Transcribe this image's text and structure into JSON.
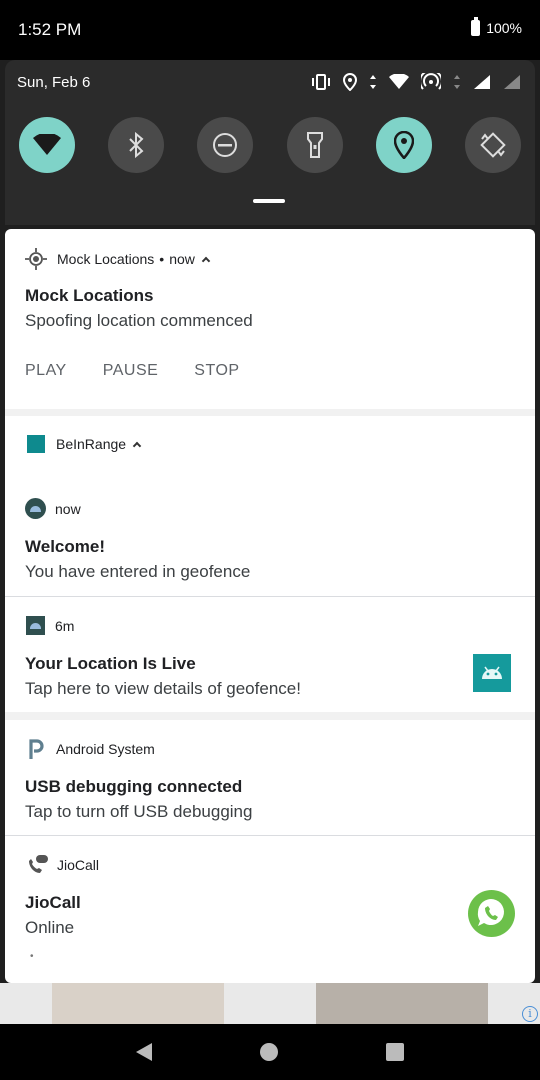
{
  "status_bar": {
    "time": "1:52 PM",
    "battery": "100%"
  },
  "quick_settings": {
    "date": "Sun, Feb 6",
    "tiles": [
      {
        "icon": "wifi-icon",
        "active": true
      },
      {
        "icon": "bluetooth-icon",
        "active": false
      },
      {
        "icon": "do-not-disturb-icon",
        "active": false
      },
      {
        "icon": "flashlight-icon",
        "active": false
      },
      {
        "icon": "location-icon",
        "active": true
      },
      {
        "icon": "auto-rotate-icon",
        "active": false
      }
    ]
  },
  "notifications": {
    "mock": {
      "app": "Mock Locations",
      "time": "now",
      "title": "Mock Locations",
      "text": "Spoofing location commenced",
      "actions": [
        "PLAY",
        "PAUSE",
        "STOP"
      ]
    },
    "beinrange": {
      "app": "BeInRange",
      "welcome": {
        "time": "now",
        "title": "Welcome!",
        "text": "You have entered in geofence"
      },
      "live": {
        "time": "6m",
        "title": "Your Location Is Live",
        "text": "Tap here to view details of geofence!"
      }
    },
    "android": {
      "app": "Android System",
      "title": "USB debugging connected",
      "text": "Tap to turn off USB debugging"
    },
    "jiocall": {
      "app": "JioCall",
      "title": "JioCall",
      "text": "Online",
      "more": "•"
    }
  },
  "colors": {
    "accent": "#7fd3c8",
    "teal_app": "#0e8a8e",
    "jio_green": "#6cc04a"
  }
}
